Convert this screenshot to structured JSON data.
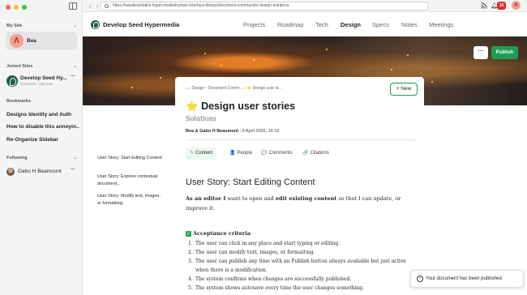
{
  "sidebar": {
    "my_site_label": "My Site",
    "my_site": {
      "avatar_letter": "Λ",
      "name": "Bea"
    },
    "joined_label": "Joined Sites",
    "joined": {
      "name": "Develop Seed Hy...",
      "sub": "Comment · just now"
    },
    "bookmarks_label": "Bookmarks",
    "bookmarks": [
      "Designs Identity and Auth",
      "How to disable this annoyin...",
      "Re-Organize Sidebar"
    ],
    "following_label": "Following",
    "following": {
      "name": "Gabo H Beamount"
    }
  },
  "browser": {
    "url": "https://seedteamtalks.hyper.media/human-interface-library/document-commands/-design-solutions",
    "notification_count": "15",
    "avatar_letter": "Λ"
  },
  "site": {
    "title": "Develop Seed Hypermedia",
    "nav": [
      {
        "label": "Projects",
        "active": false
      },
      {
        "label": "Roadmap",
        "active": false
      },
      {
        "label": "Tech",
        "active": false
      },
      {
        "label": "Design",
        "active": true
      },
      {
        "label": "Specs",
        "active": false
      },
      {
        "label": "Notes",
        "active": false
      },
      {
        "label": "Meetings",
        "active": false
      }
    ],
    "more_label": "···",
    "publish_label": "Publish"
  },
  "document": {
    "breadcrumbs": "⌂  ›  Design ›  Document Comm... ›  ⭐ Design user st...",
    "new_label": "New",
    "title_emoji": "⭐",
    "title": "Design user stories",
    "subtitle": "Solutions",
    "authors": "Bea & Gabo H Beaumont",
    "date": "8 April 2026, 16:16",
    "tabs": [
      {
        "label": "Content",
        "icon": "✎",
        "active": true
      },
      {
        "label": "People",
        "icon": "👤",
        "active": false
      },
      {
        "label": "Comments",
        "icon": "💬",
        "active": false
      },
      {
        "label": "Citations",
        "icon": "🔗",
        "active": false
      }
    ],
    "toc": [
      "User Story: Start Editing Content",
      "User Story: Explore contextual document...",
      "User Story: Modify text, images, or formatting."
    ],
    "heading": "User Story: Start Editing Content",
    "intro": {
      "bold1": "As an editor I",
      "text1": " want to open and ",
      "bold2": "edit existing content",
      "text2": " so that I can update, or improve it."
    },
    "acceptance_label": "Acceptance criteria",
    "criteria": [
      "The user can click in any place and start typing or editing.",
      "The user can modify text, images, or formatting.",
      "The user can publish any time with an Publish button always available but just active when there is a modification.",
      "The system confirms when changes are successfully published.",
      "The system shows autosave every time the user changes something."
    ]
  },
  "toast": {
    "message": "Your document has been published"
  },
  "colors": {
    "accent": "#1f9d55",
    "badge": "#d93025",
    "avatar": "#f2a290"
  }
}
